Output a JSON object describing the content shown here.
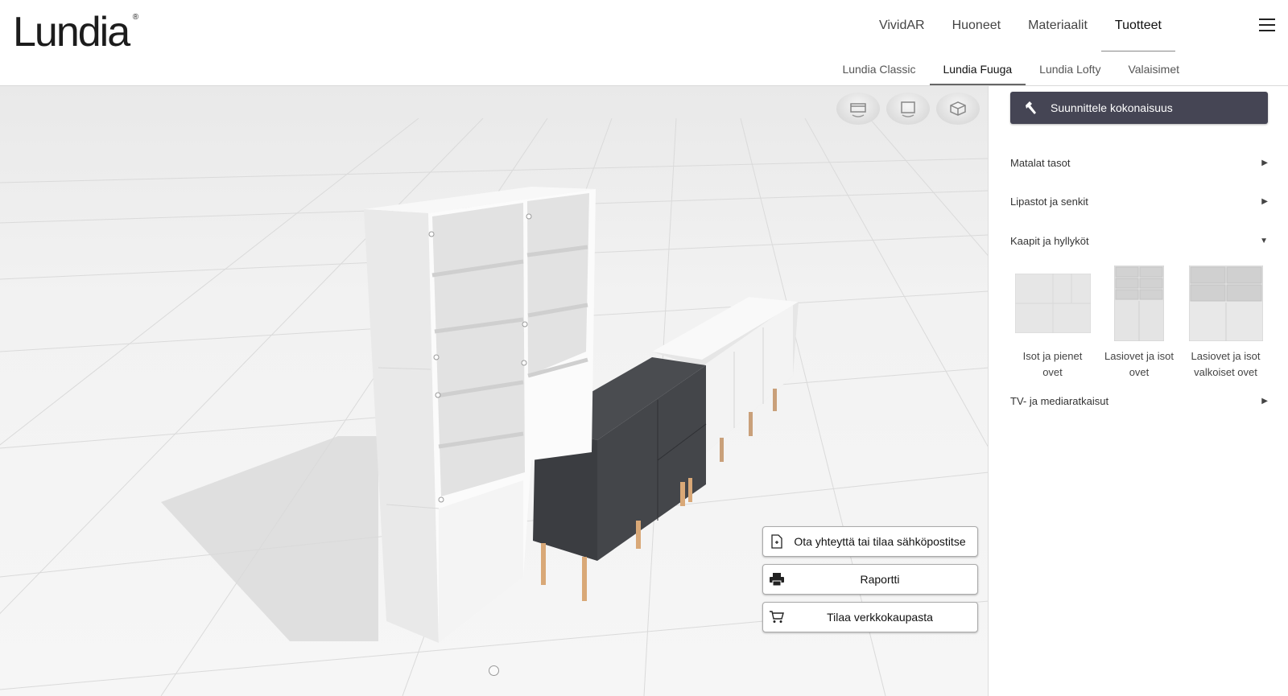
{
  "brand": {
    "logo_text": "Lundia",
    "logo_mark": "®"
  },
  "main_nav": [
    {
      "label": "VividAR"
    },
    {
      "label": "Huoneet"
    },
    {
      "label": "Materiaalit"
    },
    {
      "label": "Tuotteet",
      "active": true
    }
  ],
  "sub_nav": [
    {
      "label": "Lundia Classic"
    },
    {
      "label": "Lundia Fuuga",
      "active": true
    },
    {
      "label": "Lundia Lofty"
    },
    {
      "label": "Valaisimet"
    }
  ],
  "actions": {
    "contact_label": "Ota yhteyttä tai tilaa sähköpostitse",
    "report_label": "Raportti",
    "order_label": "Tilaa verkkokaupasta"
  },
  "sidebar": {
    "design_label": "Suunnittele kokonaisuus",
    "accordion": [
      {
        "label": "Matalat tasot",
        "expanded": false
      },
      {
        "label": "Lipastot ja senkit",
        "expanded": false
      },
      {
        "label": "Kaapit ja hyllyköt",
        "expanded": true
      },
      {
        "label": "TV- ja mediaratkaisut",
        "expanded": false
      }
    ],
    "products": [
      {
        "line1": "Isot ja pienet",
        "line2": "ovet"
      },
      {
        "line1": "Lasiovet ja isot",
        "line2": "ovet"
      },
      {
        "line1": "Lasiovet ja isot",
        "line2": "valkoiset ovet"
      }
    ]
  },
  "colors": {
    "accent_dark": "#454554",
    "viewport_bg": "#f0f0f0",
    "cabinet_dark": "#3a3c3f",
    "cabinet_white": "#eeeeee",
    "legs": "#d9a877"
  },
  "icons": {
    "view_buttons": [
      "top-view-icon",
      "front-view-icon",
      "3d-view-icon"
    ],
    "contact": "document-icon",
    "report": "printer-icon",
    "order": "cart-icon",
    "design": "hammer-icon",
    "menu": "hamburger-icon"
  }
}
